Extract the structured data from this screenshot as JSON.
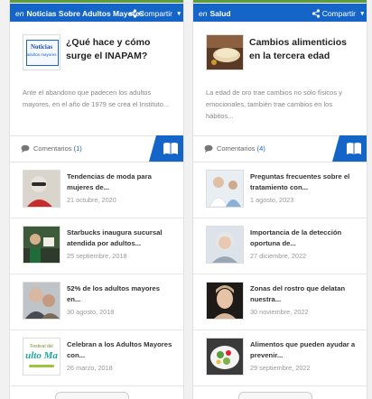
{
  "left": {
    "section_prefix": "en",
    "section": "Noticias Sobre Adultos Mayores",
    "share_label": "Compartir",
    "featured": {
      "title": "¿Qué hace y cómo surge el INAPAM?",
      "description": "Ante el abandono que padecen los adultos mayores, en el año de 1979 se crea el Instituto...",
      "thumb_word": "Noticias",
      "thumb_sub": "adultos mayores"
    },
    "comments_label": "Comentarios",
    "comments_count": "(1)",
    "items": [
      {
        "title": "Tendencias de moda para mujeres de...",
        "date": "21 octubre, 2020"
      },
      {
        "title": "Starbucks inaugura sucursal atendida por adultos...",
        "date": "25 septiembre, 2018"
      },
      {
        "title": "52% de los adultos mayores en...",
        "date": "30 agosto, 2018"
      },
      {
        "title": "Celebran a los Adultos Mayores con...",
        "date": "26 marzo, 2018",
        "thumb_top": "Festival del",
        "thumb_word": "ulto Ma"
      }
    ]
  },
  "right": {
    "section_prefix": "en",
    "section": "Salud",
    "share_label": "Compartir",
    "featured": {
      "title": "Cambios alimenticios en la tercera edad",
      "description": "La edad de oro trae cambios no sólo físicos y emocionales, también trae cambios en los hábitos..."
    },
    "comments_label": "Comentarios",
    "comments_count": "(4)",
    "items": [
      {
        "title": "Preguntas frecuentes sobre el tratamiento con...",
        "date": "1 agosto, 2023"
      },
      {
        "title": "Importancia de la detección oportuna de...",
        "date": "27 diciembre, 2022"
      },
      {
        "title": "Zonas del rostro que delatan nuestra...",
        "date": "30 noviembre, 2022"
      },
      {
        "title": "Alimentos que pueden ayudar a prevenir...",
        "date": "29 septiembre, 2022"
      }
    ]
  },
  "colors": {
    "brand_blue": "#1565c8",
    "top_green": "#5b9c3c"
  }
}
